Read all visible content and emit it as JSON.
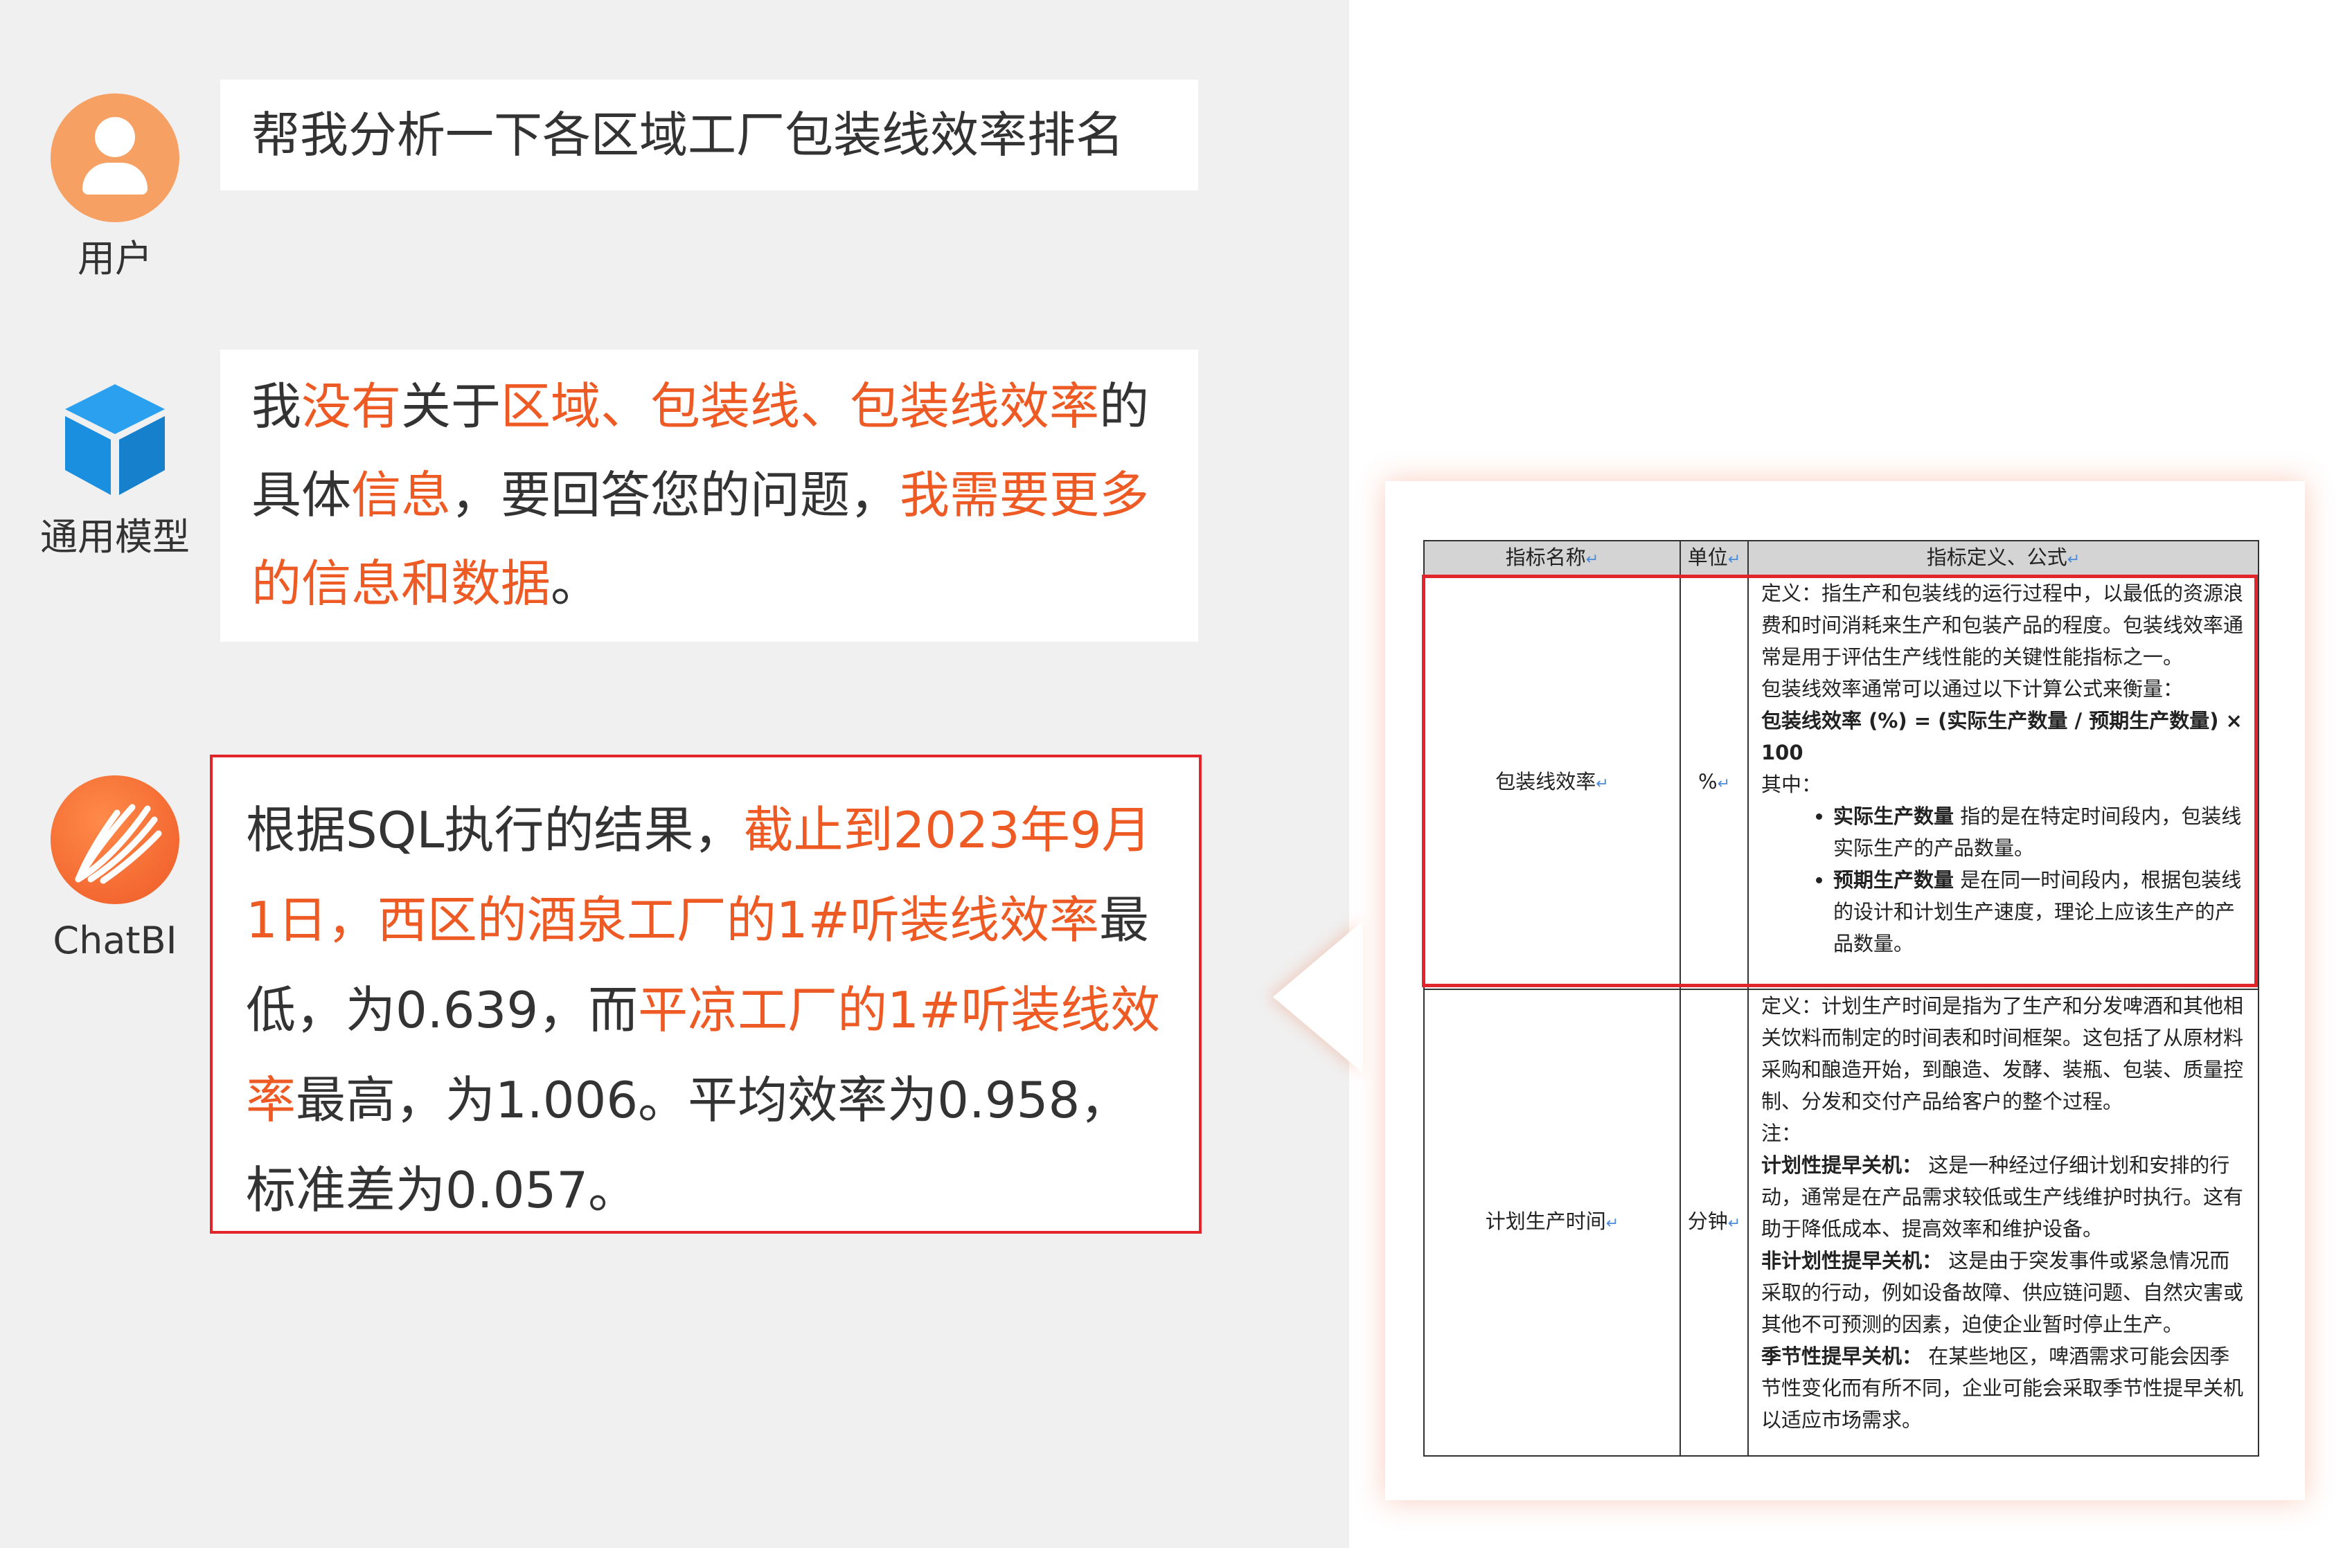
{
  "user": {
    "label": "用户",
    "message": "帮我分析一下各区域工厂包装线效率排名"
  },
  "model": {
    "label": "通用模型",
    "segments": [
      {
        "text": "我",
        "hl": false
      },
      {
        "text": "没有",
        "hl": true
      },
      {
        "text": "关于",
        "hl": false
      },
      {
        "text": "区域、包装线、包装线效率",
        "hl": true
      },
      {
        "text": "的具体",
        "hl": false
      },
      {
        "text": "信息",
        "hl": true
      },
      {
        "text": "，要回答您的问题，",
        "hl": false
      },
      {
        "text": "我需要更多的信息和数据",
        "hl": true
      },
      {
        "text": "。",
        "hl": false
      }
    ]
  },
  "chatbi": {
    "label": "ChatBI",
    "segments": [
      {
        "text": "根据SQL执行的结果，",
        "hl": false
      },
      {
        "text": "截止到2023年9月1日，西区的酒泉工厂的1#听装线效率",
        "hl": true
      },
      {
        "text": "最低，为0.639，而",
        "hl": false
      },
      {
        "text": "平凉工厂的1#听装线效率",
        "hl": true
      },
      {
        "text": "最高，为1.006。平均效率为0.958，标准差为0.057。",
        "hl": false
      }
    ]
  },
  "doc": {
    "headers": [
      "指标名称",
      "单位",
      "指标定义、公式"
    ],
    "rows": [
      {
        "name": "包装线效率",
        "unit": "%",
        "def": {
          "p1": "定义：指生产和包装线的运行过程中，以最低的资源浪费和时间消耗来生产和包装产品的程度。包装线效率通常是用于评估生产线性能的关键性能指标之一。",
          "p2": "包装线效率通常可以通过以下计算公式来衡量：",
          "formula": "包装线效率 (%) = (实际生产数量 / 预期生产数量) × 100",
          "p3": "其中：",
          "b1_term": "实际生产数量",
          "b1_text": "指的是在特定时间段内，包装线实际生产的产品数量。",
          "b2_term": "预期生产数量",
          "b2_text": "是在同一时间段内，根据包装线的设计和计划生产速度，理论上应该生产的产品数量。"
        }
      },
      {
        "name": "计划生产时间",
        "unit": "分钟",
        "def": {
          "p1": "定义：计划生产时间是指为了生产和分发啤酒和其他相关饮料而制定的时间表和时间框架。这包括了从原材料采购和酿造开始，到酿造、发酵、装瓶、包装、质量控制、分发和交付产品给客户的整个过程。",
          "p2": "注：",
          "t1_term": "计划性提早关机：",
          "t1_text": "这是一种经过仔细计划和安排的行动，通常是在产品需求较低或生产线维护时执行。这有助于降低成本、提高效率和维护设备。",
          "t2_term": "非计划性提早关机：",
          "t2_text": "这是由于突发事件或紧急情况而采取的行动，例如设备故障、供应链问题、自然灾害或其他不可预测的因素，迫使企业暂时停止生产。",
          "t3_term": "季节性提早关机：",
          "t3_text": "在某些地区，啤酒需求可能会因季节性变化而有所不同，企业可能会采取季节性提早关机以适应市场需求。"
        }
      }
    ],
    "highlight_color": "#e2242b"
  },
  "colors": {
    "accent": "#ee5a24",
    "panel_bg": "#f0f0f0",
    "user_avatar": "#f7a064",
    "model_cube": "#1a8fe0"
  },
  "icons": [
    "user-icon",
    "cube-icon",
    "chatbi-logo-icon"
  ]
}
